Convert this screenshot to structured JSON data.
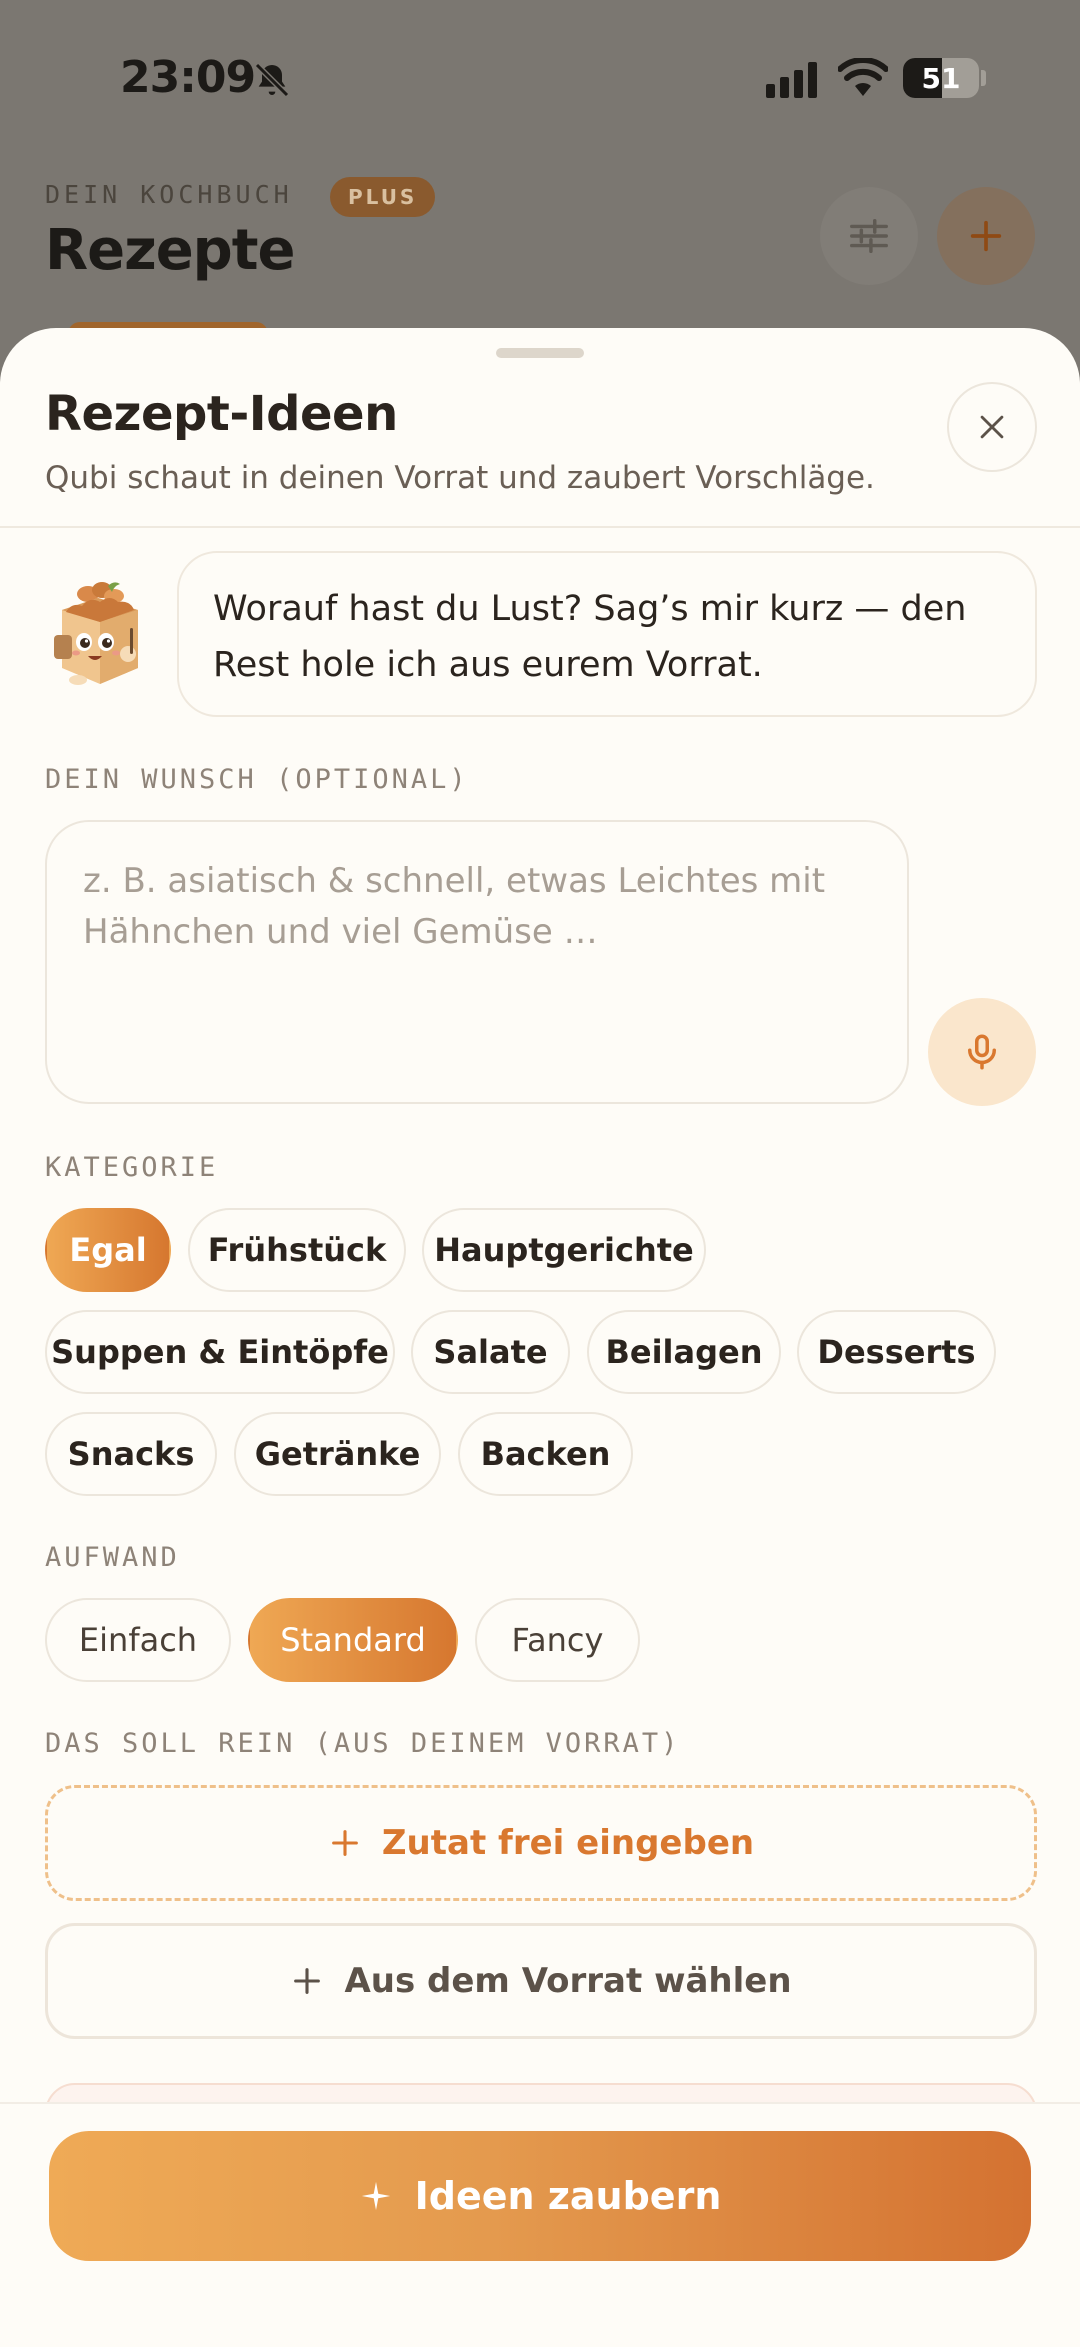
{
  "status_bar": {
    "time": "23:09",
    "battery": "51",
    "battery_level": 0.51
  },
  "background": {
    "eyebrow": "DEIN KOCHBUCH",
    "badge": "PLUS",
    "title": "Rezepte"
  },
  "sheet": {
    "title": "Rezept-Ideen",
    "subtitle": "Qubi schaut in deinen Vorrat und zaubert Vorschläge.",
    "assistant_message_line1": "Worauf hast du Lust? Sag’s mir kurz — den",
    "assistant_message_line2": "Rest hole ich aus eurem Vorrat."
  },
  "wish": {
    "label": "DEIN WUNSCH (OPTIONAL)",
    "placeholder": "z. B. asiatisch & schnell, etwas Leichtes mit Hähnchen und viel Gemüse …",
    "value": ""
  },
  "category": {
    "label": "KATEGORIE",
    "options": [
      "Egal",
      "Frühstück",
      "Hauptgerichte",
      "Suppen & Eintöpfe",
      "Salate",
      "Beilagen",
      "Desserts",
      "Snacks",
      "Getränke",
      "Backen"
    ],
    "selected": "Egal"
  },
  "effort": {
    "label": "AUFWAND",
    "options": [
      "Einfach",
      "Standard",
      "Fancy"
    ],
    "selected": "Standard"
  },
  "ingredients": {
    "label": "DAS SOLL REIN (AUS DEINEM VORRAT)",
    "free_entry_label": "Zutat frei eingeben",
    "pantry_label": "Aus dem Vorrat wählen"
  },
  "cta": {
    "label": "Ideen zaubern"
  },
  "colors": {
    "accent": "#E08A3C",
    "accent_light": "#FAE6CC",
    "background": "#FEFCF7",
    "text": "#2B241E",
    "muted": "#8E8378"
  },
  "icons": [
    "bell-slash-icon",
    "signal-icon",
    "wifi-icon",
    "battery-icon",
    "sliders-icon",
    "plus-icon",
    "close-icon",
    "mascot-icon",
    "microphone-icon",
    "sparkle-icon"
  ]
}
